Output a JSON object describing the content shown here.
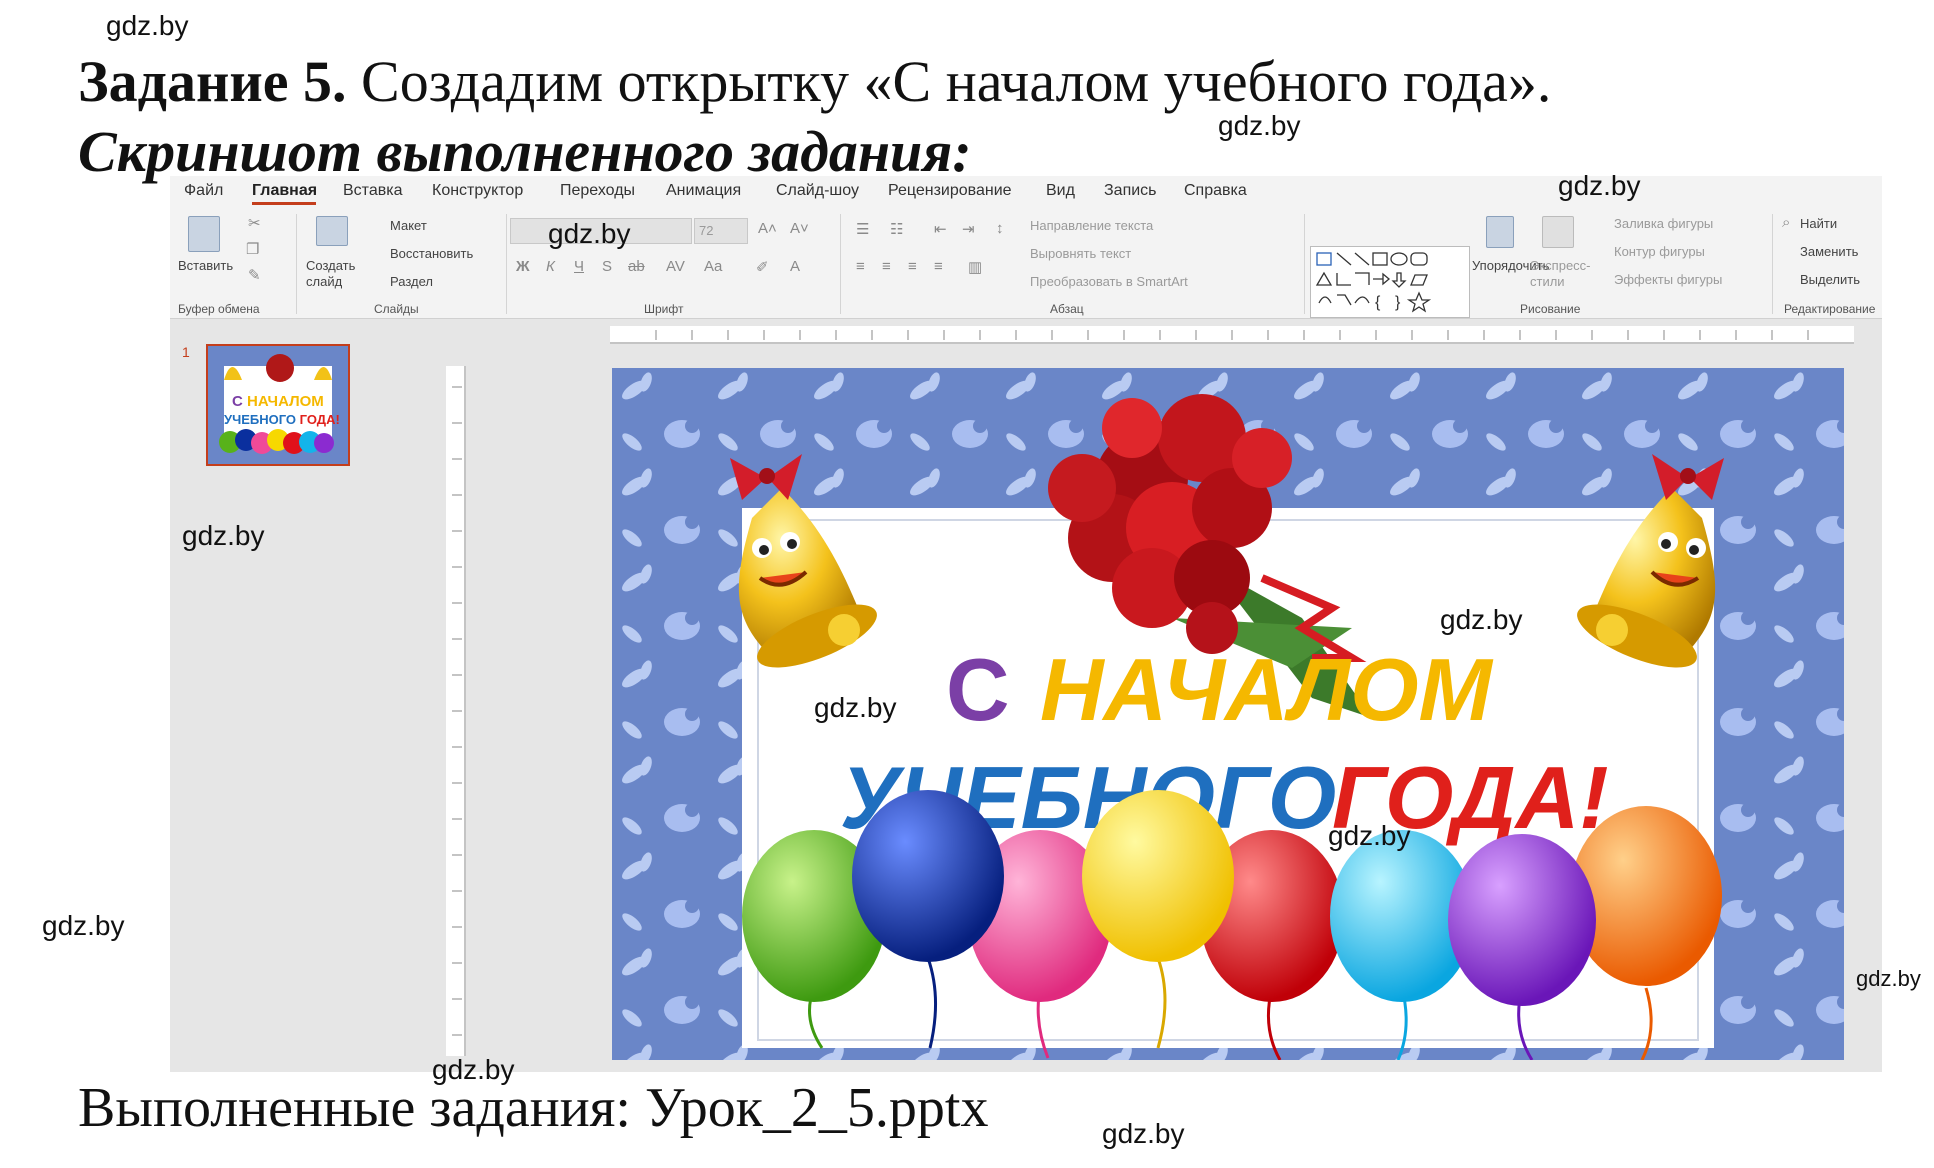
{
  "watermark": "gdz.by",
  "task": {
    "label": "Задание 5.",
    "text": " Создадим открытку «С началом учебного года».",
    "subtitle": "Скриншот выполненного задания:",
    "done": "Выполненные задания: Урок_2_5.pptx"
  },
  "ppt": {
    "menu": [
      "Файл",
      "Главная",
      "Вставка",
      "Конструктор",
      "Переходы",
      "Анимация",
      "Слайд-шоу",
      "Рецензирование",
      "Вид",
      "Запись",
      "Справка"
    ],
    "ribbon": {
      "paste": "Вставить",
      "clipboard_group": "Буфер обмена",
      "create_slide": "Создать слайд",
      "layout": "Макет",
      "reset": "Восстановить",
      "section": "Раздел",
      "slides_group": "Слайды",
      "font_size": "72",
      "font_group": "Шрифт",
      "text_direction": "Направление текста",
      "align_text": "Выровнять текст",
      "smartart": "Преобразовать в SmartArt",
      "paragraph_group": "Абзац",
      "arrange": "Упорядочить",
      "quick_styles": "Экспресс-стили",
      "shape_fill": "Заливка фигуры",
      "shape_outline": "Контур фигуры",
      "shape_effects": "Эффекты фигуры",
      "drawing_group": "Рисование",
      "find": "Найти",
      "replace": "Заменить",
      "select": "Выделить",
      "editing_group": "Редактирование"
    },
    "slide_number": "1",
    "card": {
      "line1_a": "С",
      "line1_b": "НАЧАЛОМ",
      "line2_a": "УЧЕБНОГО",
      "line2_b": "ГОДА!"
    }
  },
  "colors": {
    "accent": "#c43e1c",
    "card_bg": "#6a86c8",
    "text_purple": "#7b3fa6",
    "text_yellow": "#f5b800",
    "text_blue": "#1f6fbf",
    "text_red": "#e0201b"
  }
}
